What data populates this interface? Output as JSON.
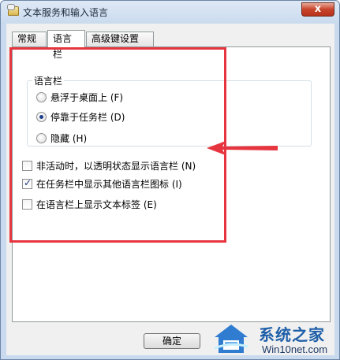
{
  "window": {
    "title": "文本服务和输入语言",
    "close_label": "x"
  },
  "tabs": [
    {
      "label": "常规",
      "active": false
    },
    {
      "label": "语言栏",
      "active": true
    },
    {
      "label": "高级键设置",
      "active": false
    }
  ],
  "language_bar": {
    "group_label": "语言栏",
    "options": [
      {
        "label": "悬浮于桌面上 (F)",
        "selected": false
      },
      {
        "label": "停靠于任务栏 (D)",
        "selected": true
      },
      {
        "label": "隐藏 (H)",
        "selected": false
      }
    ]
  },
  "checkboxes": [
    {
      "label": "非活动时，以透明状态显示语言栏 (N)",
      "checked": false
    },
    {
      "label": "在任务栏中显示其他语言栏图标 (I)",
      "checked": true
    },
    {
      "label": "在语言栏上显示文本标签 (E)",
      "checked": false
    }
  ],
  "buttons": {
    "ok": "确定"
  },
  "watermark": {
    "line1": "系统之家",
    "line2": "Win10net.com"
  },
  "colors": {
    "highlight": "#e7353f",
    "accent": "#1f5fa8"
  }
}
